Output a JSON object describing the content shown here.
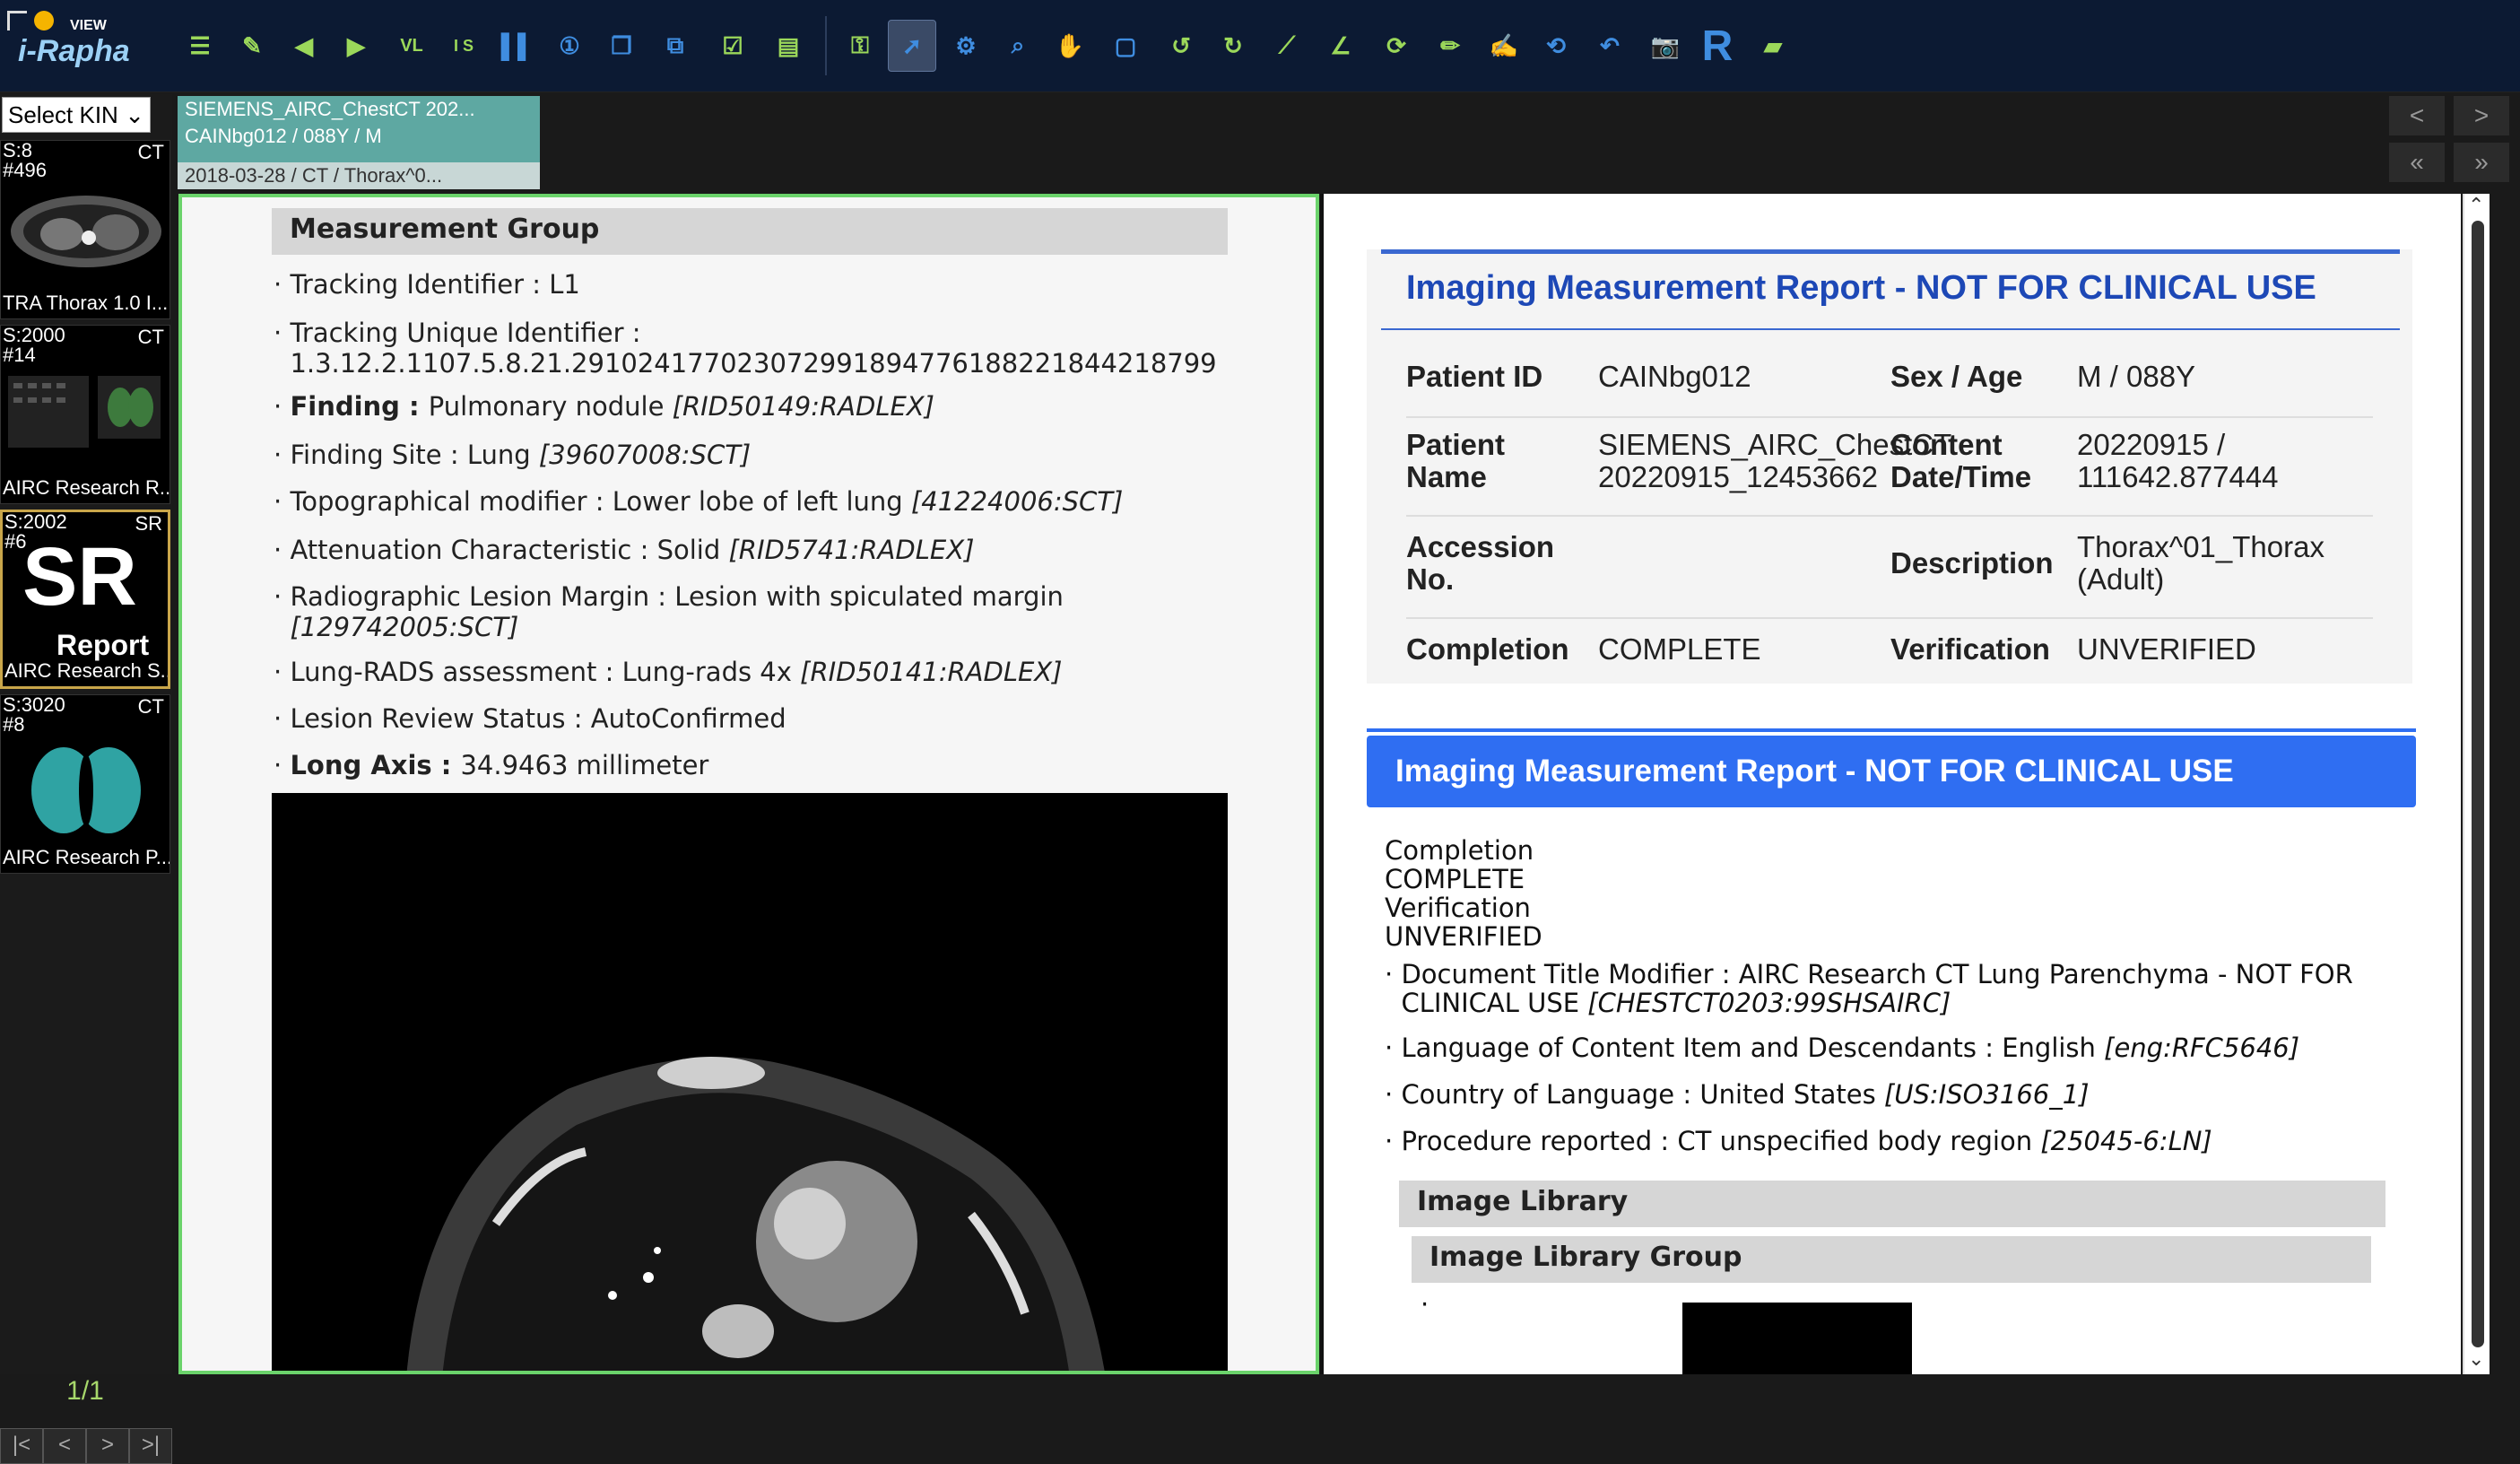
{
  "app": {
    "logo_view": "VIEW",
    "logo_name": "i-Rapha",
    "toolbar_icons": [
      "list-icon",
      "notes-icon",
      "prev-icon",
      "next-icon",
      "vl-icon",
      "is-icon",
      "layout-icon",
      "one-icon",
      "stack-icon",
      "split-icon",
      "check-icon",
      "report-icon",
      "key-icon",
      "pointer-icon",
      "gear-icon",
      "zoom-icon",
      "pan-icon",
      "fit-icon",
      "rotate-left-icon",
      "rotate-right-icon",
      "ruler-icon",
      "angle-icon",
      "reset-icon",
      "pencil-icon",
      "annotate-icon",
      "sync-icon",
      "undo-icon",
      "camera-icon",
      "r-icon",
      "export-icon"
    ]
  },
  "sidebar": {
    "kin_select": "Select KIN",
    "thumbs": [
      {
        "series": "S:8",
        "number": "#496",
        "modality": "CT",
        "desc": "TRA Thorax 1.0 I..."
      },
      {
        "series": "S:2000",
        "number": "#14",
        "modality": "CT",
        "desc": "AIRC Research R..."
      },
      {
        "series": "S:2002",
        "number": "#6",
        "modality": "SR",
        "big": "SR",
        "sub": "Report",
        "desc": "AIRC Research S..."
      },
      {
        "series": "S:3020",
        "number": "#8",
        "modality": "CT",
        "desc": "AIRC Research P..."
      }
    ],
    "page": "1/1",
    "pager": [
      "|<",
      "<",
      ">",
      ">|"
    ]
  },
  "study_tab": {
    "title": "SIEMENS_AIRC_ChestCT 202...",
    "patient": "CAINbg012 / 088Y / M",
    "date": "2018-03-28 / CT / Thorax^0..."
  },
  "nav": {
    "prev": "<",
    "next": ">",
    "first": "«",
    "last": "»"
  },
  "left": {
    "group_title": "Measurement Group",
    "rows": [
      {
        "label": "Tracking Identifier : ",
        "value": "L1"
      },
      {
        "label": "Tracking Unique Identifier : ",
        "value": "1.3.12.2.1107.5.8.21.291024177023072991894776188221844218799"
      },
      {
        "label": "Finding : ",
        "value": "Pulmonary nodule ",
        "code": "[RID50149:RADLEX]"
      },
      {
        "label": "Finding Site : ",
        "value": "Lung ",
        "code": "[39607008:SCT]"
      },
      {
        "label": "Topographical modifier : ",
        "value": "Lower lobe of left lung ",
        "code": "[41224006:SCT]"
      },
      {
        "label": "Attenuation Characteristic : ",
        "value": "Solid ",
        "code": "[RID5741:RADLEX]"
      },
      {
        "label": "Radiographic Lesion Margin : ",
        "value": "Lesion with spiculated margin ",
        "code": "[129742005:SCT]"
      },
      {
        "label": "Lung-RADS assessment : ",
        "value": "Lung-rads 4x ",
        "code": "[RID50141:RADLEX]"
      },
      {
        "label": "Lesion Review Status : ",
        "value": "AutoConfirmed"
      },
      {
        "label": "Long Axis : ",
        "value": "34.9463 millimeter"
      }
    ]
  },
  "right": {
    "card_title": "Imaging Measurement Report - NOT FOR CLINICAL USE",
    "patient_id_label": "Patient ID",
    "patient_id": "CAINbg012",
    "sex_age_label": "Sex / Age",
    "sex_age": "M / 088Y",
    "patient_name_label_1": "Patient",
    "patient_name_label_2": "Name",
    "patient_name_1": "SIEMENS_AIRC_ChestCT",
    "patient_name_2": "20220915_12453662",
    "content_dt_label_1": "Content",
    "content_dt_label_2": "Date/Time",
    "content_dt_1": "20220915 /",
    "content_dt_2": "111642.877444",
    "accession_label_1": "Accession",
    "accession_label_2": "No.",
    "description_label": "Description",
    "description_1": "Thorax^01_Thorax",
    "description_2": "(Adult)",
    "completion_label": "Completion",
    "completion": "COMPLETE",
    "verification_label": "Verification",
    "verification": "UNVERIFIED",
    "blue_title": "Imaging Measurement Report - NOT FOR CLINICAL USE",
    "plain": [
      "Completion",
      "COMPLETE",
      "Verification",
      "UNVERIFIED"
    ],
    "bullets": [
      {
        "label": "Document Title Modifier : ",
        "value": "AIRC Research CT Lung Parenchyma - NOT FOR",
        "value2": "CLINICAL USE ",
        "code": "[CHESTCT0203:99SHSAIRC]"
      },
      {
        "label": "Language of Content Item and Descendants : ",
        "value": "English ",
        "code": "[eng:RFC5646]"
      },
      {
        "label": "Country of Language : ",
        "value": "United States ",
        "code": "[US:ISO3166_1]"
      },
      {
        "label": "Procedure reported : ",
        "value": "CT unspecified body region ",
        "code": "[25045-6:LN]"
      }
    ],
    "library": "Image Library",
    "library_group": "Image Library Group",
    "dot": "·"
  },
  "colors": {
    "toolbar_bg": "#0c1a33",
    "accent_blue": "#2f6ef2",
    "active_border": "#6bd36b",
    "tab_teal": "#5ea8a2"
  }
}
